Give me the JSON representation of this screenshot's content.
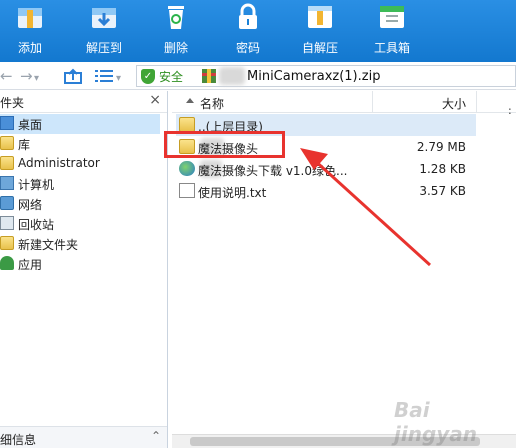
{
  "toolbar": {
    "buttons": [
      {
        "label": "添加",
        "icon": "add-icon"
      },
      {
        "label": "解压到",
        "icon": "extract-to-icon"
      },
      {
        "label": "删除",
        "icon": "delete-icon"
      },
      {
        "label": "密码",
        "icon": "password-icon"
      },
      {
        "label": "自解压",
        "icon": "self-extract-icon"
      },
      {
        "label": "工具箱",
        "icon": "toolbox-icon"
      }
    ]
  },
  "address": {
    "safe_label": "安全",
    "path": "MiniCameraxz(1).zip"
  },
  "left_pane": {
    "header": "件夹",
    "close": "×",
    "items": [
      {
        "label": "桌面",
        "icon": "desktop-icon"
      },
      {
        "label": "库",
        "icon": "library-icon"
      },
      {
        "label": "Administrator",
        "icon": "user-icon"
      },
      {
        "label": "计算机",
        "icon": "computer-icon"
      },
      {
        "label": "网络",
        "icon": "network-icon"
      },
      {
        "label": "回收站",
        "icon": "recycle-bin-icon"
      },
      {
        "label": "新建文件夹",
        "icon": "folder-icon"
      },
      {
        "label": "应用",
        "icon": "app-icon"
      }
    ],
    "footer": "细信息"
  },
  "file_list": {
    "columns": {
      "name": "名称",
      "size": "大小"
    },
    "rows": [
      {
        "name": "..(上层目录)",
        "size": ""
      },
      {
        "name": "魔法摄像头",
        "size": "2.79 MB"
      },
      {
        "name": "魔法摄像头下载 v1.0绿色...",
        "size": "1.28 KB"
      },
      {
        "name": "使用说明.txt",
        "size": "3.57 KB"
      }
    ]
  },
  "colors": {
    "toolbar": "#1a82d8",
    "highlight": "#e8332e",
    "safe": "#40a536"
  }
}
